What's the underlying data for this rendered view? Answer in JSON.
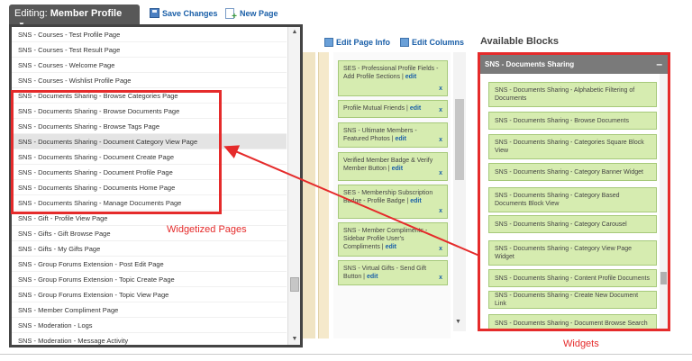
{
  "toolbar": {
    "editing_prefix": "Editing:",
    "editing_value": "Member Profile",
    "save_label": "Save Changes",
    "new_label": "New Page"
  },
  "page_list": [
    "SNS - Courses - Test Profile Page",
    "SNS - Courses - Test Result Page",
    "SNS - Courses - Welcome Page",
    "SNS - Courses - Wishlist Profile Page",
    "SNS - Documents Sharing - Browse Categories Page",
    "SNS - Documents Sharing - Browse Documents Page",
    "SNS - Documents Sharing - Browse Tags Page",
    "SNS - Documents Sharing - Document Category View Page",
    "SNS - Documents Sharing - Document Create Page",
    "SNS - Documents Sharing - Document Profile Page",
    "SNS - Documents Sharing - Documents Home Page",
    "SNS - Documents Sharing - Manage Documents Page",
    "SNS - Gift - Profile View Page",
    "SNS - Gifts - Gift Browse Page",
    "SNS - Gifts - My Gifts Page",
    "SNS - Group Forums Extension - Post Edit Page",
    "SNS - Group Forums Extension - Topic Create Page",
    "SNS - Group Forums Extension - Topic View Page",
    "SNS - Member Compliment Page",
    "SNS - Moderation - Logs",
    "SNS - Moderation - Message Activity"
  ],
  "annotations": {
    "widgetized_pages": "Widgetized Pages",
    "widgets": "Widgets"
  },
  "layout_header": {
    "edit_page_info": "Edit Page Info",
    "edit_columns": "Edit Columns"
  },
  "layout_widgets": [
    {
      "title": "SES - Professional Profile Fields - Add Profile Sections |",
      "edit": "edit",
      "x": "x"
    },
    {
      "title": "Profile Mutual Friends |",
      "edit": "edit",
      "x": "x"
    },
    {
      "title": "SNS - Ultimate Members - Featured Photos |",
      "edit": "edit",
      "x": "x"
    },
    {
      "title": "Verified Member Badge & Verify Member Button |",
      "edit": "edit",
      "x": "x"
    },
    {
      "title": "SES - Membership Subscription Badge - Profile Badge |",
      "edit": "edit",
      "x": "x"
    },
    {
      "title": "SNS - Member Compliments - Sidebar Profile User's Compliments |",
      "edit": "edit",
      "x": "x"
    },
    {
      "title": "SNS - Virtual Gifts - Send Gift Button |",
      "edit": "edit",
      "x": "x"
    }
  ],
  "available_blocks": {
    "title": "Available Blocks",
    "group": "SNS - Documents Sharing",
    "collapse_symbol": "–",
    "items": [
      "SNS - Documents Sharing - Alphabetic Filtering of Documents",
      "SNS - Documents Sharing - Browse Documents",
      "SNS - Documents Sharing - Categories Square Block View",
      "SNS - Documents Sharing - Category Banner Widget",
      "SNS - Documents Sharing - Category Based Documents Block View",
      "SNS - Documents Sharing - Category Carousel",
      "SNS - Documents Sharing - Category View Page Widget",
      "SNS - Documents Sharing - Content Profile Documents",
      "SNS - Documents Sharing - Create New Document Link",
      "SNS - Documents Sharing - Document Browse Search"
    ]
  },
  "colors": {
    "accent_red": "#e52b2b",
    "widget_green": "#d6ecb0",
    "link_blue": "#1a5fa8"
  }
}
